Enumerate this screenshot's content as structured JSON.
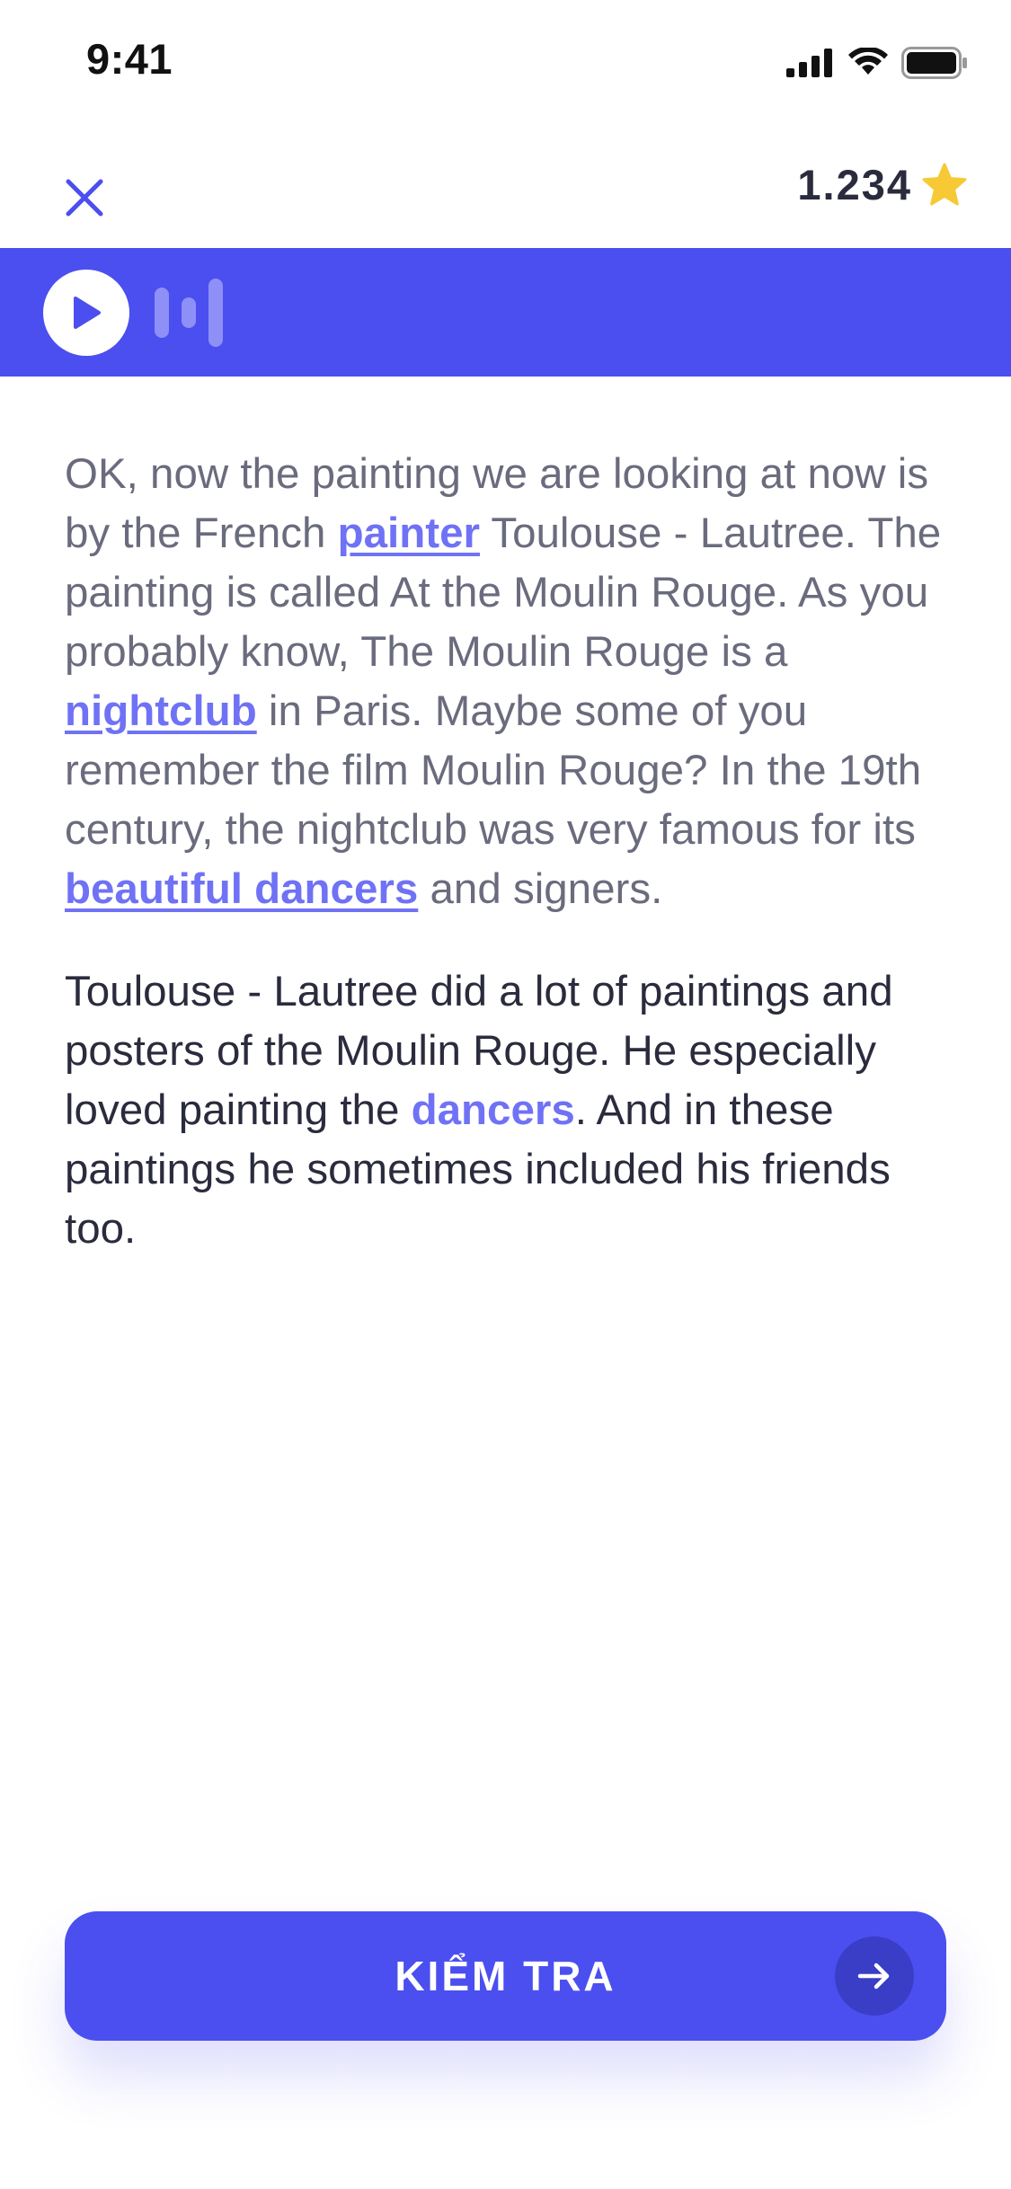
{
  "status_bar": {
    "time": "9:41"
  },
  "header": {
    "score": "1.234",
    "close_icon": "close-icon",
    "star_icon": "star-icon"
  },
  "audio": {
    "play_icon": "play-icon",
    "waveform_icon": "waveform-icon"
  },
  "transcript": {
    "paragraph1": {
      "t1": "OK, now the painting we are looking at now is by the French ",
      "w1": "painter",
      "t2": " Toulouse - Lautree. The painting is called At the Moulin Rouge. As you probably know, The Moulin Rouge is a ",
      "w2": "nightclub",
      "t3": " in Paris. Maybe some of you remember the film Moulin Rouge? In the 19th century, the nightclub was very famous for its ",
      "w3": "beautiful dancers",
      "t4": " and signers."
    },
    "paragraph2": {
      "t1": "Toulouse - Lautree did a lot of paintings and posters of the Moulin Rouge. He especially loved painting the ",
      "w1": "dancers",
      "t2": ". And in these paintings he sometimes included his friends too."
    }
  },
  "footer": {
    "check_label": "KIỂM TRA",
    "arrow_icon": "arrow-right-icon"
  },
  "colors": {
    "accent": "#4b4fef",
    "highlight": "#6f72f5",
    "star": "#f7c934"
  }
}
